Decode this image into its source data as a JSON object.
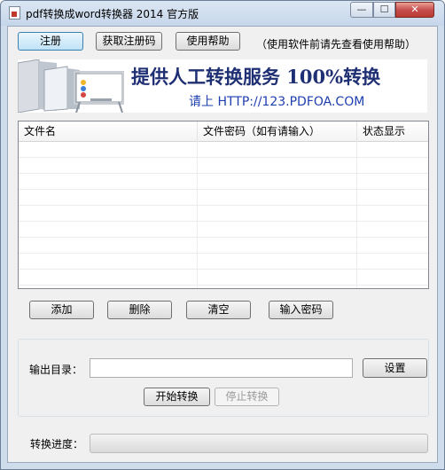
{
  "window": {
    "title": "pdf转换成word转换器 2014 官方版",
    "controls": {
      "minimize": "—",
      "maximize": "☐",
      "close": "✕"
    }
  },
  "toolbar": {
    "register_label": "注册",
    "get_code_label": "获取注册码",
    "help_label": "使用帮助",
    "hint": "（使用软件前请先查看使用帮助）"
  },
  "banner": {
    "slogan": "提供人工转换服务 100%转换",
    "url_text": "请上  HTTP://123.PDFOA.COM"
  },
  "file_list": {
    "columns": [
      "文件名",
      "文件密码（如有请输入）",
      "状态显示"
    ],
    "rows": []
  },
  "actions": {
    "add_label": "添加",
    "delete_label": "删除",
    "clear_label": "清空",
    "password_label": "输入密码"
  },
  "output": {
    "dir_label": "输出目录：",
    "dir_value": "",
    "settings_label": "设置",
    "start_label": "开始转换",
    "stop_label": "停止转换"
  },
  "progress": {
    "label": "转换进度：",
    "value": 0
  },
  "colors": {
    "slogan": "#1f2f73",
    "url": "#1f3fb0",
    "titlebar": "#c6d6ea",
    "close_button": "#c75050"
  }
}
